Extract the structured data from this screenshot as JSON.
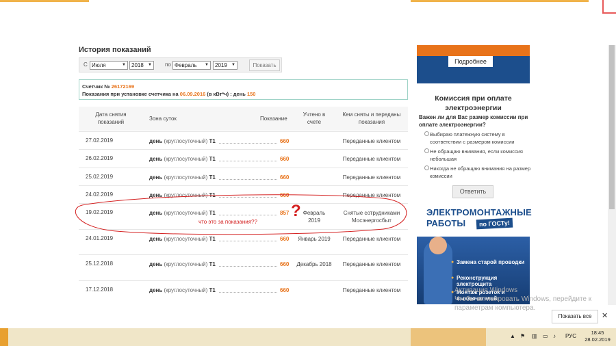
{
  "section_title": "История показаний",
  "filter": {
    "from_label": "С",
    "from_month": "Июля",
    "from_year": "2018",
    "to_label": "по",
    "to_month": "Февраль",
    "to_year": "2019",
    "show_button": "Показать"
  },
  "meter_info": {
    "line1_label": "Счетчик №",
    "meter_number": "26172169",
    "line2_label": "Показания при установке счетчика на",
    "install_date": "06.09.2016",
    "line2_mid": "(в кВт*ч) : день",
    "install_value": "150"
  },
  "table": {
    "headers": {
      "date": "Дата снятия показаний",
      "zone": "Зона суток",
      "reading": "Показание",
      "accounted": "Учтено в счете",
      "by": "Кем сняты и переданы показания"
    },
    "rows": [
      {
        "date": "27.02.2019",
        "zone": "день",
        "zone_sub": "(круглосуточный)",
        "tariff": "T1",
        "value": "660",
        "accounted": "",
        "by": "Переданные клиентом"
      },
      {
        "date": "26.02.2019",
        "zone": "день",
        "zone_sub": "(круглосуточный)",
        "tariff": "T1",
        "value": "660",
        "accounted": "",
        "by": "Переданные клиентом"
      },
      {
        "date": "25.02.2019",
        "zone": "день",
        "zone_sub": "(круглосуточный)",
        "tariff": "T1",
        "value": "660",
        "accounted": "",
        "by": "Переданные клиентом"
      },
      {
        "date": "24.02.2019",
        "zone": "день",
        "zone_sub": "(круглосуточный)",
        "tariff": "T1",
        "value": "660",
        "accounted": "",
        "by": "Переданные клиентом"
      },
      {
        "date": "19.02.2019",
        "zone": "день",
        "zone_sub": "(круглосуточный)",
        "tariff": "T1",
        "value": "857",
        "accounted": "Февраль 2019",
        "by": "Снятые сотрудниками Мосэнергосбыт"
      },
      {
        "date": "24.01.2019",
        "zone": "день",
        "zone_sub": "(круглосуточный)",
        "tariff": "T1",
        "value": "660",
        "accounted": "Январь 2019",
        "by": "Переданные клиентом"
      },
      {
        "date": "25.12.2018",
        "zone": "день",
        "zone_sub": "(круглосуточный)",
        "tariff": "T1",
        "value": "660",
        "accounted": "Декабрь 2018",
        "by": "Переданные клиентом"
      },
      {
        "date": "17.12.2018",
        "zone": "день",
        "zone_sub": "(круглосуточный)",
        "tariff": "T1",
        "value": "660",
        "accounted": "",
        "by": "Переданные клиентом"
      }
    ]
  },
  "annotation": {
    "text": "что  это за показания??",
    "mark": "?"
  },
  "sidebar": {
    "banner_button": "Подробнее",
    "poll_title": "Комиссия при оплате электроэнергии",
    "poll_question": "Важен ли для Вас размер комиссии при оплате электроэнергии?",
    "options": [
      "Выбираю платежную систему в соответствии с размером комиссии",
      "Не обращаю внимания, если комиссия небольшая",
      "Никогда не обращаю внимания на размер комиссии"
    ],
    "answer_button": "Ответить",
    "ad_title1": "ЭЛЕКТРОМОНТАЖНЫЕ",
    "ad_title2": "РАБОТЫ",
    "ad_gost": "по ГОСТу!",
    "ad_items": [
      "Замена старой проводки",
      "Реконструкция электрощита",
      "Монтаж розеток и выключателей"
    ]
  },
  "watermark": {
    "line1": "Активация Windows",
    "line2": "Чтобы активировать Windows, перейдите к",
    "line3": "параметрам компьютера."
  },
  "downloads": {
    "show_all": "Показать все"
  },
  "taskbar": {
    "lang": "РУС",
    "time": "18:45",
    "date": "28.02.2019"
  },
  "colors": {
    "accent_orange": "#e8731a",
    "brand_blue": "#1c4e8c",
    "annotation_red": "#d42020"
  }
}
